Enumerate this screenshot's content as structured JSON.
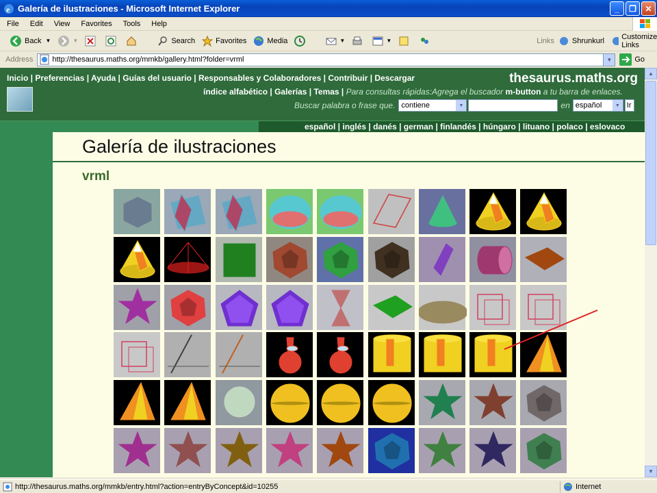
{
  "window": {
    "title": "Galería de ilustraciones - Microsoft Internet Explorer"
  },
  "menu": [
    "File",
    "Edit",
    "View",
    "Favorites",
    "Tools",
    "Help"
  ],
  "toolbar": {
    "back": "Back",
    "search": "Search",
    "favorites": "Favorites",
    "media": "Media",
    "links_label": "Links",
    "link1": "Shrunkurl",
    "link2": "Customize Links"
  },
  "address": {
    "label": "Address",
    "url": "http://thesaurus.maths.org/mmkb/gallery.html?folder=vrml",
    "go": "Go"
  },
  "site": {
    "name": "thesaurus.maths.org",
    "toplinks": "Inicio | Preferencias | Ayuda | Guías del usuario | Responsables y Colaboradores | Contribuir | Descargar",
    "nav2_a": "índice alfabético",
    "nav2_b": "| Galerías | Temas |",
    "nav2_note": "Para consultas rápidas:Agrega el buscador",
    "nav2_btn": "m-button",
    "nav2_tail": "a tu barra de enlaces.",
    "search_label": "Buscar palabra o frase que.",
    "search_mode": "contiene",
    "search_in": "en",
    "search_lang": "español",
    "search_go": "Ir",
    "languages": "español | inglés | danés | german | finlandés | húngaro | lituano | polaco | eslovaco"
  },
  "main": {
    "title": "Galería de ilustraciones",
    "folder": "vrml"
  },
  "status": {
    "url": "http://thesaurus.maths.org/mmkb/entry.html?action=entryByConcept&id=10255",
    "zone": "Internet"
  },
  "colors": {
    "site_header": "#2f6b3b",
    "content_bg": "#fdfde6",
    "annotation": "#e02020"
  },
  "thumbnails": [
    [
      "#8aa6a0",
      "#6a7d90",
      "hexagon"
    ],
    [
      "#9aa8b8",
      "#58a8c8",
      "planes"
    ],
    [
      "#9aa8b8",
      "#58a8c8",
      "planes"
    ],
    [
      "#7ac870",
      "#58c8d0",
      "sphere-cap"
    ],
    [
      "#7ac870",
      "#58c8d0",
      "sphere-cap"
    ],
    [
      "#c0c0c0",
      "#d04040",
      "wire-prism"
    ],
    [
      "#6870a0",
      "#40c080",
      "cone"
    ],
    [
      "#000000",
      "#f0d020",
      "cone-cut"
    ],
    [
      "#000000",
      "#f0d020",
      "cone-cut"
    ],
    [
      "#000000",
      "#f0d020",
      "cone-cut"
    ],
    [
      "#000000",
      "#e02020",
      "wire-cone"
    ],
    [
      "#b0b8b0",
      "#208020",
      "cube"
    ],
    [
      "#908880",
      "#a04830",
      "polyhedron"
    ],
    [
      "#6070a8",
      "#30a040",
      "polyhedron"
    ],
    [
      "#a0a0a0",
      "#403020",
      "polyhedron"
    ],
    [
      "#a090b0",
      "#8040c0",
      "prism"
    ],
    [
      "#9090a0",
      "#a03870",
      "cylinder"
    ],
    [
      "#b0b0b8",
      "#a04810",
      "bipyramid"
    ],
    [
      "#a0a0a8",
      "#a030a0",
      "star"
    ],
    [
      "#a0a0a8",
      "#e04040",
      "polyhedron"
    ],
    [
      "#b8b8c0",
      "#7030d0",
      "pentagon"
    ],
    [
      "#b8b8c0",
      "#7030d0",
      "pentagon"
    ],
    [
      "#c0c0c8",
      "#c07070",
      "double-cone"
    ],
    [
      "#c8c8c8",
      "#20a020",
      "bipyramid"
    ],
    [
      "#c8c8c8",
      "#9a8a60",
      "ellipse"
    ],
    [
      "#c8c8c8",
      "#d04060",
      "wire-cube"
    ],
    [
      "#c8c8c8",
      "#d04060",
      "wire-cube"
    ],
    [
      "#c8c8c8",
      "#d04060",
      "wire-cube"
    ],
    [
      "#b0b0b0",
      "#404040",
      "lines"
    ],
    [
      "#b0b0b0",
      "#c06020",
      "lines"
    ],
    [
      "#000000",
      "#e04030",
      "cone-light"
    ],
    [
      "#000000",
      "#e04030",
      "cone-light"
    ],
    [
      "#000000",
      "#f0d020",
      "cylinder-y"
    ],
    [
      "#000000",
      "#f0d020",
      "cylinder-y"
    ],
    [
      "#000000",
      "#f0d020",
      "cylinder-y"
    ],
    [
      "#000000",
      "#f09020",
      "cone-y"
    ],
    [
      "#000000",
      "#f09020",
      "cone-y"
    ],
    [
      "#000000",
      "#f09020",
      "cone-y"
    ],
    [
      "#9098a0",
      "#c0d8c0",
      "sphere"
    ],
    [
      "#000000",
      "#f0c020",
      "sphere-y"
    ],
    [
      "#000000",
      "#f0c020",
      "sphere-y"
    ],
    [
      "#000000",
      "#f0c020",
      "sphere-y"
    ],
    [
      "#a8a8b0",
      "#208050",
      "star"
    ],
    [
      "#a8a8b0",
      "#804030",
      "star"
    ],
    [
      "#a8a8b0",
      "#706868",
      "polyhedron"
    ],
    [
      "#a8a0b0",
      "#a03090",
      "star"
    ],
    [
      "#a8a0b0",
      "#905050",
      "star"
    ],
    [
      "#a8a0b0",
      "#806010",
      "star"
    ],
    [
      "#a8a0b0",
      "#c04080",
      "star"
    ],
    [
      "#a8a0b0",
      "#a04810",
      "star"
    ],
    [
      "#2030a0",
      "#2070b0",
      "polyhedron"
    ],
    [
      "#a8a0b0",
      "#408040",
      "star"
    ],
    [
      "#a8a0b0",
      "#302860",
      "star"
    ],
    [
      "#a8a0b0",
      "#408050",
      "polyhedron"
    ]
  ]
}
